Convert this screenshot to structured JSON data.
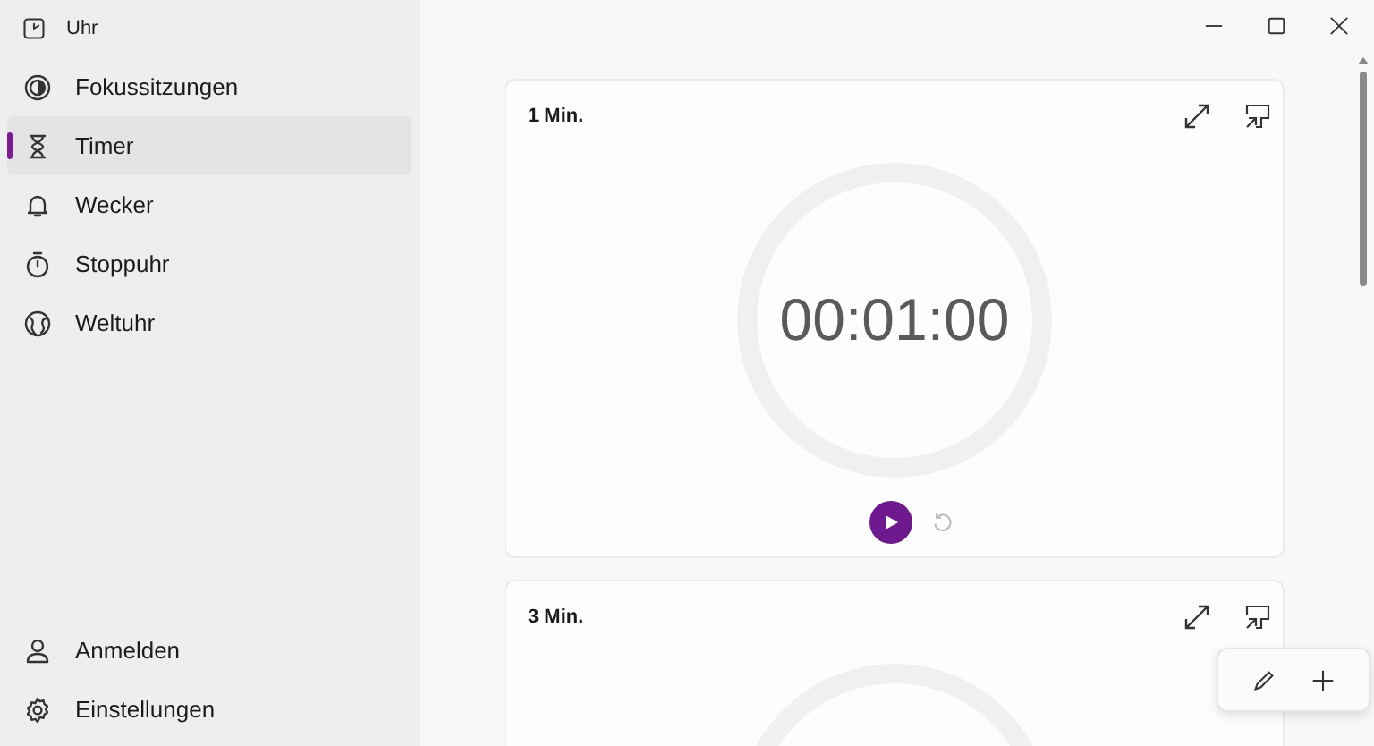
{
  "app_title": "Uhr",
  "nav": [
    {
      "label": "Fokussitzungen",
      "kind": "focus",
      "selected": false
    },
    {
      "label": "Timer",
      "kind": "timer",
      "selected": true
    },
    {
      "label": "Wecker",
      "kind": "alarm",
      "selected": false
    },
    {
      "label": "Stoppuhr",
      "kind": "stopwatch",
      "selected": false
    },
    {
      "label": "Weltuhr",
      "kind": "worldclock",
      "selected": false
    }
  ],
  "nav_footer": [
    {
      "label": "Anmelden",
      "kind": "account"
    },
    {
      "label": "Einstellungen",
      "kind": "settings"
    }
  ],
  "timers": [
    {
      "title": "1 Min.",
      "time": "00:01:00"
    },
    {
      "title": "3 Min."
    }
  ]
}
